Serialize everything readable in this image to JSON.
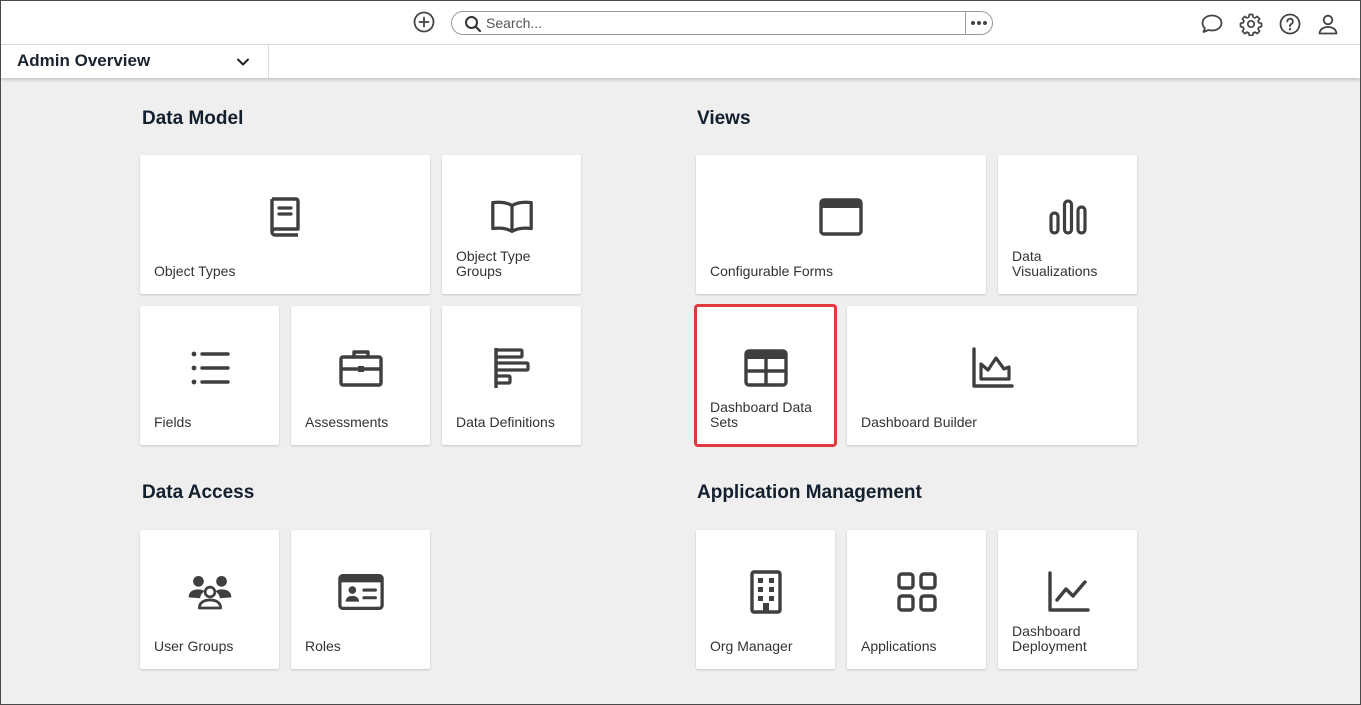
{
  "header": {
    "search_placeholder": "Search...",
    "workspace_label": "Admin Overview"
  },
  "sections": {
    "data_model": {
      "title": "Data Model",
      "tiles": {
        "object_types": "Object Types",
        "object_type_groups": "Object Type Groups",
        "fields": "Fields",
        "assessments": "Assessments",
        "data_definitions": "Data Definitions"
      }
    },
    "views": {
      "title": "Views",
      "tiles": {
        "configurable_forms": "Configurable Forms",
        "data_visualizations": "Data Visualizations",
        "dashboard_data_sets": "Dashboard Data Sets",
        "dashboard_builder": "Dashboard Builder"
      }
    },
    "data_access": {
      "title": "Data Access",
      "tiles": {
        "user_groups": "User Groups",
        "roles": "Roles"
      }
    },
    "application_management": {
      "title": "Application Management",
      "tiles": {
        "org_manager": "Org Manager",
        "applications": "Applications",
        "dashboard_deployment": "Dashboard Deployment"
      }
    }
  },
  "colors": {
    "icon": "#3f3f3f",
    "highlight": "#e0393e",
    "background": "#efefef"
  }
}
